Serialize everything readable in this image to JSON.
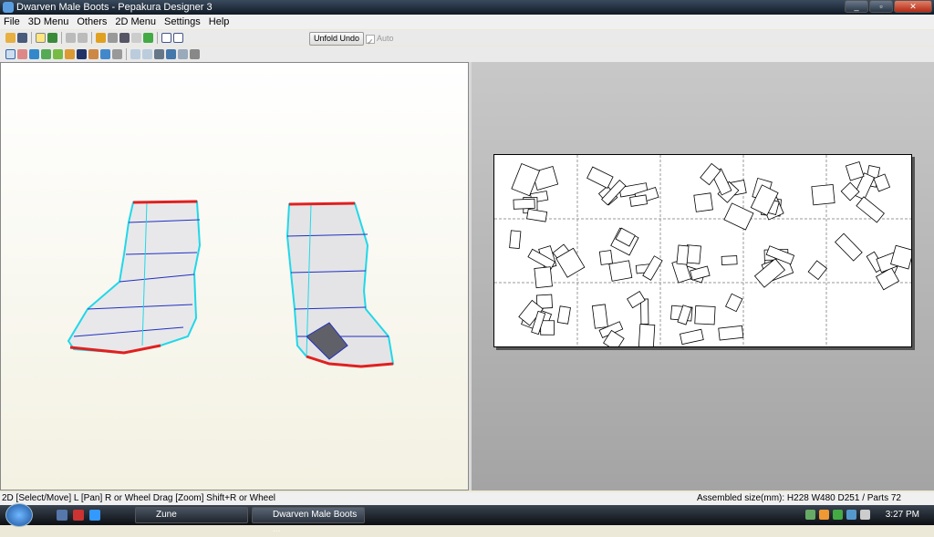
{
  "window": {
    "title": "Dwarven Male Boots - Pepakura Designer 3"
  },
  "menu": [
    "File",
    "3D Menu",
    "Others",
    "2D Menu",
    "Settings",
    "Help"
  ],
  "toolbar": {
    "unfold_undo": "Unfold Undo",
    "auto_label": "Auto",
    "auto_checked": true
  },
  "status": {
    "left": "2D [Select/Move] L [Pan] R or Wheel Drag [Zoom] Shift+R or Wheel",
    "right": "Assembled size(mm): H228 W480 D251 / Parts 72"
  },
  "taskbar": {
    "items": [
      "Zune",
      "Dwarven Male Boots ..."
    ],
    "clock": "3:27 PM"
  },
  "colors": {
    "edge_cut": "#e02020",
    "edge_mountain": "#20d8e8",
    "edge_valley": "#2030c0"
  },
  "paper": {
    "columns": 5,
    "rows": 3
  }
}
